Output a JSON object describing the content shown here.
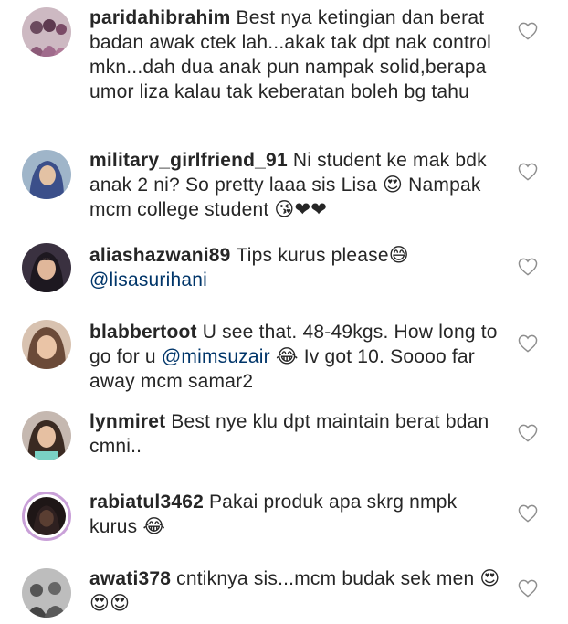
{
  "comments": [
    {
      "username": "paridahibrahim",
      "text": "Best nya ketingian dan berat badan awak ctek lah...akak tak dpt nak control mkn...dah dua anak pun nampak solid,berapa umor liza kalau tak keberatan boleh bg tahu",
      "mention": "",
      "suffix": "",
      "avatar_color": "#6b4a5e",
      "avatar_icon": "avatar-photo-icon"
    },
    {
      "username": "military_girlfriend_91",
      "text": "Ni student ke mak bdk anak 2 ni? So pretty laaa sis Lisa 😍 Nampak mcm college student 😘❤❤",
      "mention": "",
      "suffix": "",
      "avatar_color": "#3b4f8a",
      "avatar_icon": "avatar-photo-icon"
    },
    {
      "username": "aliashazwani89",
      "text": "Tips kurus please😅",
      "mention": "@lisasurihani",
      "suffix": "",
      "avatar_color": "#2b2430",
      "avatar_icon": "avatar-photo-icon"
    },
    {
      "username": "blabbertoot",
      "text": "U see that. 48-49kgs. How long to go for u",
      "mention": "@mimsuzair",
      "suffix": "😂 Iv got 10. Soooo far away mcm samar2",
      "avatar_color": "#b98a73",
      "avatar_icon": "avatar-photo-icon"
    },
    {
      "username": "lynmiret",
      "text": "Best nye klu dpt maintain berat bdan cmni..",
      "mention": "",
      "suffix": "",
      "avatar_color": "#4d3a2e",
      "avatar_icon": "avatar-photo-icon"
    },
    {
      "username": "rabiatul3462",
      "text": "Pakai produk apa skrg nmpk kurus 😂",
      "mention": "",
      "suffix": "",
      "avatar_color": "#231b1b",
      "avatar_icon": "avatar-photo-icon"
    },
    {
      "username": "awati378",
      "text": "cntiknya sis...mcm budak sek men 😍😍😍",
      "mention": "",
      "suffix": "",
      "avatar_color": "#8a8a8a",
      "avatar_icon": "avatar-photo-icon"
    }
  ],
  "like_icon": "heart-outline-icon",
  "colors": {
    "text": "#262626",
    "mention": "#003569",
    "heart_stroke": "#8e8e8e",
    "story_ring": "#c9a0d8"
  }
}
